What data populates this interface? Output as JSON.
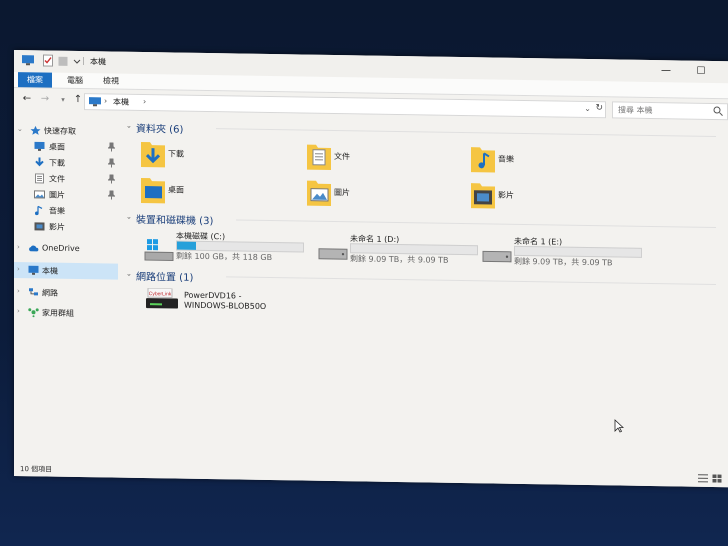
{
  "window": {
    "title": "本機"
  },
  "ribbon": {
    "tabs": [
      "檔案",
      "電腦",
      "檢視"
    ]
  },
  "address": {
    "path": "本機",
    "search_placeholder": "搜尋 本機"
  },
  "nav_pane": {
    "quick_access": "快速存取",
    "quick_items": [
      {
        "label": "桌面",
        "icon": "desktop-icon",
        "pinned": true
      },
      {
        "label": "下載",
        "icon": "download-icon",
        "pinned": true
      },
      {
        "label": "文件",
        "icon": "document-icon",
        "pinned": true
      },
      {
        "label": "圖片",
        "icon": "picture-icon",
        "pinned": true
      },
      {
        "label": "音樂",
        "icon": "music-icon",
        "pinned": false
      },
      {
        "label": "影片",
        "icon": "video-icon",
        "pinned": false
      }
    ],
    "onedrive": "OneDrive",
    "this_pc": "本機",
    "network": "網路",
    "homegroup": "家用群組"
  },
  "content": {
    "folders_header": "資料夾 (6)",
    "folders": [
      "下載",
      "文件",
      "音樂",
      "桌面",
      "圖片",
      "影片"
    ],
    "devices_header": "裝置和磁碟機 (3)",
    "drives": [
      {
        "name": "本機磁碟 (C:)",
        "size": "剩餘 100 GB，共 118 GB",
        "used_fraction": 0.15
      },
      {
        "name": "未命名 1 (D:)",
        "size": "剩餘 9.09 TB，共 9.09 TB",
        "used_fraction": 0.0
      },
      {
        "name": "未命名 1 (E:)",
        "size": "剩餘 9.09 TB，共 9.09 TB",
        "used_fraction": 0.0
      }
    ],
    "network_header": "網路位置 (1)",
    "network_item": {
      "line1": "PowerDVD16 -",
      "line2": "WINDOWS-BLOB50O",
      "brand": "CyberLink"
    }
  },
  "status": {
    "items": "10 個項目"
  },
  "colors": {
    "accent": "#1d6fc2",
    "folder": "#f5c542",
    "drive_fill": "#26a0da"
  }
}
